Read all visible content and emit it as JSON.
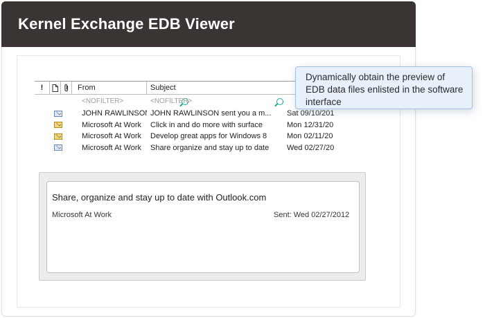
{
  "window": {
    "title": "Kernel Exchange EDB Viewer"
  },
  "grid": {
    "columns": {
      "importance": "!",
      "from": "From",
      "subject": "Subject"
    },
    "filter": {
      "from": "<NOFILTER>",
      "subject": "<NOFILTER>"
    },
    "rows": [
      {
        "icon": "envelope-open-icon",
        "from": "JOHN RAWLINSON",
        "subject": "JOHN RAWLINSON sent you a m...",
        "date": "Sat 09/10/201"
      },
      {
        "icon": "envelope-closed-icon",
        "from": "Microsoft At Work",
        "subject": "Click in and do more with surface",
        "date": "Mon 12/31/20"
      },
      {
        "icon": "envelope-closed-icon",
        "from": "Microsoft At Work",
        "subject": "Develop great apps for Windows 8",
        "date": "Mon 02/11/20"
      },
      {
        "icon": "envelope-open-icon",
        "from": "Microsoft At Work",
        "subject": "Share organize and stay up to date",
        "date": "Wed 02/27/20"
      }
    ]
  },
  "preview": {
    "subject": "Share, organize and stay up to date with Outlook.com",
    "from": "Microsoft At Work",
    "sent": "Sent: Wed 02/27/2012"
  },
  "tooltip": {
    "text": "Dynamically obtain the preview of EDB data files enlisted in the software interface"
  },
  "colors": {
    "titlebar": "#3a3532",
    "tooltip_bg": "#e7f0fb",
    "tooltip_border": "#9dc1ea",
    "search_icon": "#1aa39a"
  }
}
